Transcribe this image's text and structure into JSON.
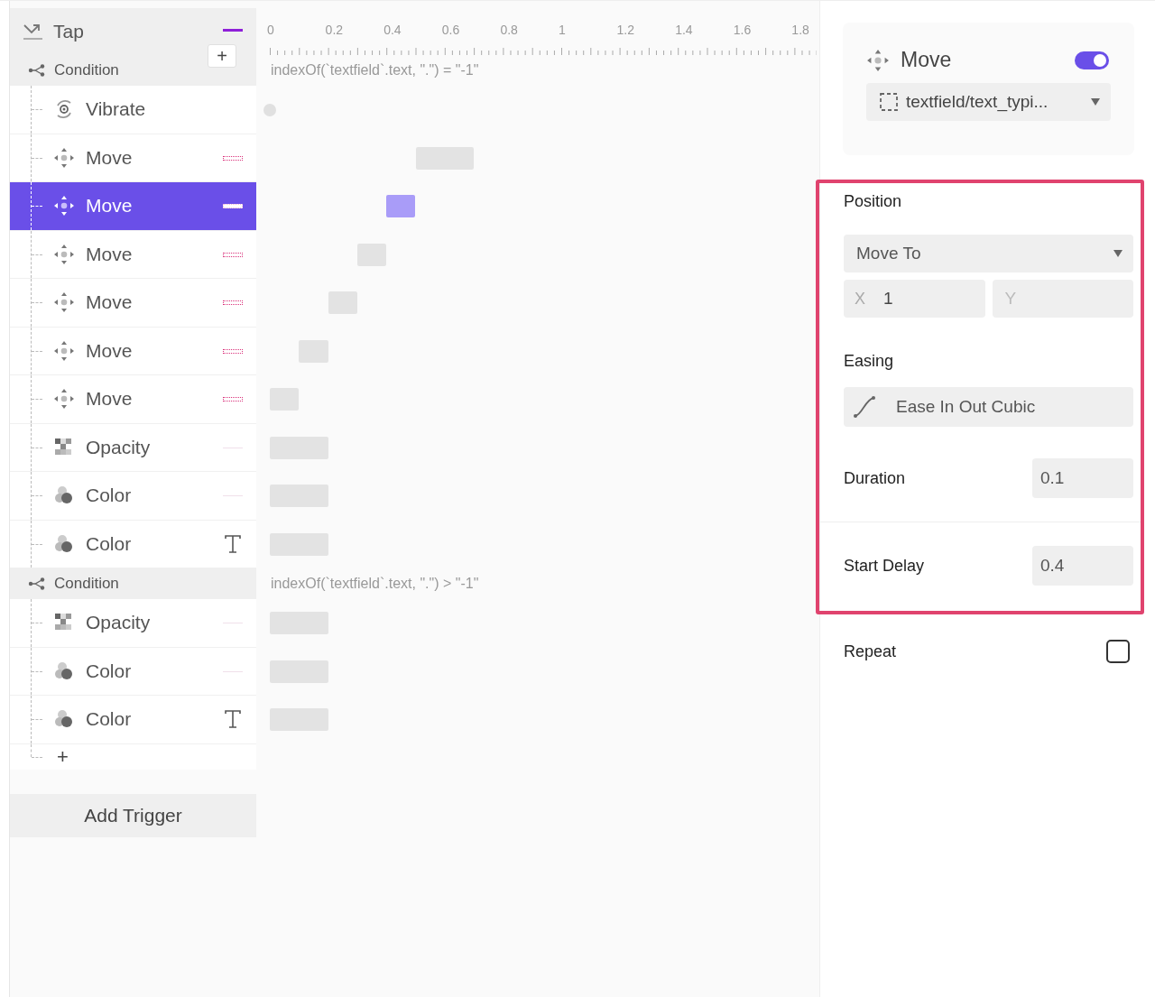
{
  "trigger": {
    "label": "Tap",
    "add_button": "+"
  },
  "ruler": [
    "0",
    "0.2",
    "0.4",
    "0.6",
    "0.8",
    "1",
    "1.2",
    "1.4",
    "1.6",
    "1.8"
  ],
  "groups": [
    {
      "condition": "Condition",
      "expression": "indexOf(`textfield`.text, \".\") = \"-1\"",
      "actions": [
        {
          "kind": "vibrate",
          "label": "Vibrate",
          "selected": false
        },
        {
          "kind": "move",
          "label": "Move",
          "badge": {
            "kind": "dotted"
          },
          "selected": false
        },
        {
          "kind": "move",
          "label": "Move",
          "badge": {
            "kind": "dotted"
          },
          "selected": true
        },
        {
          "kind": "move",
          "label": "Move",
          "badge": {
            "kind": "dotted"
          },
          "selected": false
        },
        {
          "kind": "move",
          "label": "Move",
          "badge": {
            "kind": "dotted"
          },
          "selected": false
        },
        {
          "kind": "move",
          "label": "Move",
          "badge": {
            "kind": "dotted"
          },
          "selected": false
        },
        {
          "kind": "move",
          "label": "Move",
          "badge": {
            "kind": "dotted"
          },
          "selected": false
        },
        {
          "kind": "opacity",
          "label": "Opacity",
          "badge": {
            "kind": "line"
          },
          "selected": false
        },
        {
          "kind": "color",
          "label": "Color",
          "badge": {
            "kind": "line"
          },
          "selected": false
        },
        {
          "kind": "color",
          "label": "Color",
          "badge": {
            "kind": "text"
          },
          "selected": false
        }
      ]
    },
    {
      "condition": "Condition",
      "expression": "indexOf(`textfield`.text, \".\") > \"-1\"",
      "actions": [
        {
          "kind": "opacity",
          "label": "Opacity",
          "badge": {
            "kind": "line"
          },
          "selected": false
        },
        {
          "kind": "color",
          "label": "Color",
          "badge": {
            "kind": "line"
          },
          "selected": false
        },
        {
          "kind": "color",
          "label": "Color",
          "badge": {
            "kind": "text"
          },
          "selected": false
        }
      ]
    }
  ],
  "add_action": "+",
  "add_trigger": "Add Trigger",
  "inspector": {
    "title": "Move",
    "enabled": true,
    "target": "textfield/text_typi...",
    "position": {
      "label": "Position",
      "mode": "Move To",
      "x_label": "X",
      "x_value": "1",
      "y_placeholder": "Y"
    },
    "easing": {
      "label": "Easing",
      "value": "Ease In Out Cubic"
    },
    "duration": {
      "label": "Duration",
      "value": "0.1"
    },
    "start_delay": {
      "label": "Start Delay",
      "value": "0.4"
    },
    "repeat": {
      "label": "Repeat",
      "checked": false
    }
  }
}
